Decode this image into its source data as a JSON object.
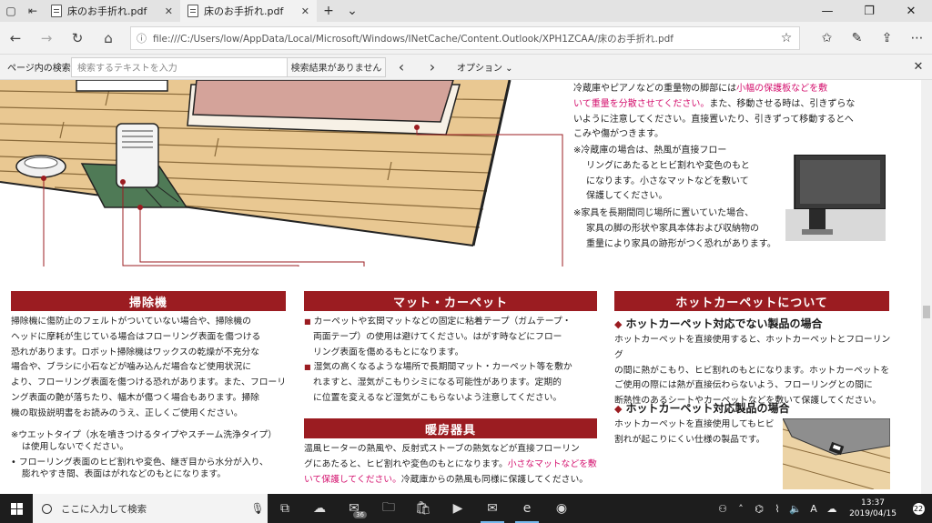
{
  "tabs": [
    {
      "title": "床のお手折れ.pdf",
      "active": false
    },
    {
      "title": "床のお手折れ.pdf",
      "active": true
    }
  ],
  "address": {
    "url": "file:///C:/Users/low/AppData/Local/Microsoft/Windows/INetCache/Content.Outlook/XPH1ZCAA/床のお手折れ.pdf"
  },
  "findbar": {
    "label": "ページ内の検索",
    "placeholder": "検索するテキストを入力",
    "status": "検索結果がありません",
    "options": "オプション"
  },
  "doc": {
    "right_top": {
      "lines": [
        "冷蔵庫やピアノなどの重量物の脚部には",
        "小幅の保護板などを敷",
        "いて重量を分散させてください。",
        "また、移動させる時は、引きずらな",
        "いように注意してください。直接置いたり、引きずって移動するとへ",
        "こみや傷がつきます。"
      ],
      "note1": [
        "※冷蔵庫の場合は、熱風が直接フロー",
        "リングにあたるとヒビ割れや変色のもと",
        "になります。小さなマットなどを敷いて",
        "保護してください。"
      ],
      "note2": [
        "※家具を長期間同じ場所に置いていた場合、",
        "家具の脚の形状や家具本体および収納物の",
        "重量により家具の跡形がつく恐れがあります。"
      ]
    },
    "sections": {
      "cleaner": {
        "title": "掃除機",
        "lines": [
          "掃除機に傷防止のフェルトがついていない場合や、掃除機の",
          "ヘッドに摩耗が生じている場合はフローリング表面を傷つける",
          "恐れがあります。ロボット掃除機はワックスの乾燥が不充分な",
          "場合や、ブラシに小石などが噛み込んだ場合など使用状況に",
          "より、フローリング表面を傷つける恐れがあります。また、フローリ",
          "ング表面の艶が落ちたり、幅木が傷つく場合もあります。掃除",
          "機の取扱説明書をお読みのうえ、正しくご使用ください。"
        ],
        "note1": [
          "※ウエットタイプ（水を噴きつけるタイプやスチーム洗浄タイプ）",
          "は使用しないでください。"
        ],
        "note2": [
          "フローリング表面のヒビ割れや変色、継ぎ目から水分が入り、",
          "膨れやすき間、表面はがれなどのもとになります。"
        ]
      },
      "mat": {
        "title": "マット・カーペット",
        "b1": [
          "カーペットや玄関マットなどの固定に粘着テープ（ガムテープ・",
          "両面テープ）の使用は避けてください。はがす時などにフロー",
          "リング表面を傷めるもとになります。"
        ],
        "b2": [
          "湿気の高くなるような場所で長期間マット・カーペット等を敷か",
          "れますと、湿気がこもりシミになる可能性があります。定期的",
          "に位置を変えるなど湿気がこもらないよう注意してください。"
        ]
      },
      "heater": {
        "title": "暖房器具",
        "l1": "温風ヒーターの熱風や、反射式ストーブの熱気などが直接フローリン",
        "l2a": "グにあたると、ヒビ割れや変色のもとになります。",
        "l2b": "小さなマットなどを敷",
        "l3a": "いて保護してください。",
        "l3b": "冷蔵庫からの熱風も同様に保護してください。"
      },
      "hotcarpet": {
        "title": "ホットカーペットについて",
        "sub1": "ホットカーペット対応でない製品の場合",
        "lines1": [
          "ホットカーペットを直接使用すると、ホットカーペットとフローリング",
          "の間に熱がこもり、ヒビ割れのもとになります。ホットカーペットを",
          "ご使用の際には熱が直接伝わらないよう、フローリングとの間に",
          "断熱性のあるシートやカーペットなどを敷いて保護してください。"
        ],
        "sub2": "ホットカーペット対応製品の場合",
        "lines2": [
          "ホットカーペットを直接使用してもヒビ",
          "割れが起こりにくい仕様の製品です。"
        ]
      }
    }
  },
  "taskbar": {
    "search_placeholder": "ここに入力して検索",
    "badge_count": "36",
    "time": "13:37",
    "date": "2019/04/15",
    "notif_count": "22"
  }
}
